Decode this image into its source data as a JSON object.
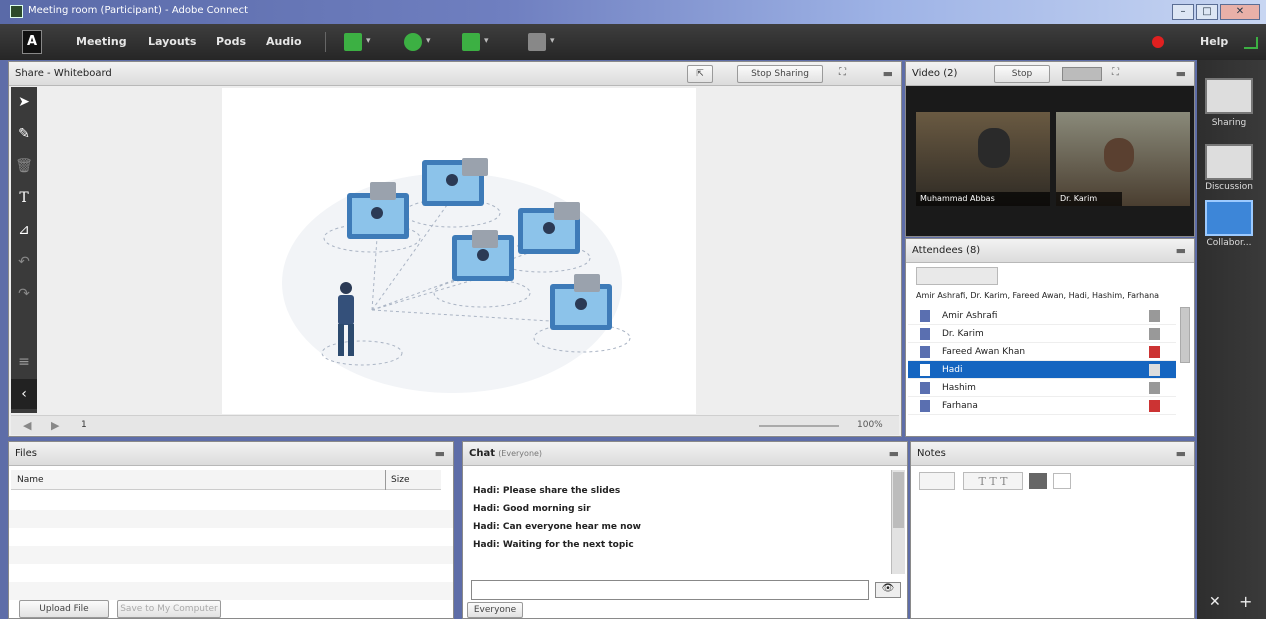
{
  "window": {
    "title": "Meeting room (Participant) - Adobe Connect",
    "controls": [
      "–",
      "□",
      "✕"
    ]
  },
  "menubar": {
    "items": [
      "Meeting",
      "Layouts",
      "Pods",
      "Audio"
    ],
    "help_label": "Help"
  },
  "share_pod": {
    "title": "Share - Whiteboard",
    "stop_sharing_label": "Stop Sharing",
    "page_number": "1",
    "zoom": "100%"
  },
  "video_pod": {
    "title": "Video (2)",
    "stop_label": "Stop",
    "participants": [
      {
        "name": "Muhammad Abbas"
      },
      {
        "name": "Dr. Karim"
      }
    ]
  },
  "attendees_pod": {
    "title": "Attendees (8)",
    "summary": "Amir Ashrafi, Dr. Karim, Fareed Awan, Hadi, Hashim, Farhana",
    "rows": [
      {
        "name": "Amir Ashrafi",
        "status": "mic"
      },
      {
        "name": "Dr. Karim",
        "status": "mic"
      },
      {
        "name": "Fareed Awan Khan",
        "status": "muted"
      },
      {
        "name": "Hadi",
        "status": "selected"
      },
      {
        "name": "Hashim",
        "status": "mic"
      },
      {
        "name": "Farhana",
        "status": "muted"
      }
    ]
  },
  "files_pod": {
    "title": "Files",
    "col_name": "Name",
    "col_size": "Size",
    "upload_label": "Upload File",
    "save_label": "Save to My Computer"
  },
  "chat_pod": {
    "title": "Chat",
    "subtitle": "(Everyone)",
    "messages": [
      "Hadi: Please share the slides",
      "Hadi: Good morning sir",
      "Hadi: Can everyone hear me now",
      "Hadi: Waiting for the next topic"
    ],
    "input_placeholder": "",
    "tab_label": "Everyone"
  },
  "notes_pod": {
    "title": "Notes"
  },
  "layouts_sidebar": {
    "items": [
      "Sharing",
      "Discussion",
      "Collabor..."
    ]
  },
  "colors": {
    "menubar": "#2e2e2e",
    "selected_row": "#1565c0",
    "accent_green": "#3cb043",
    "record_red": "#e02020"
  }
}
